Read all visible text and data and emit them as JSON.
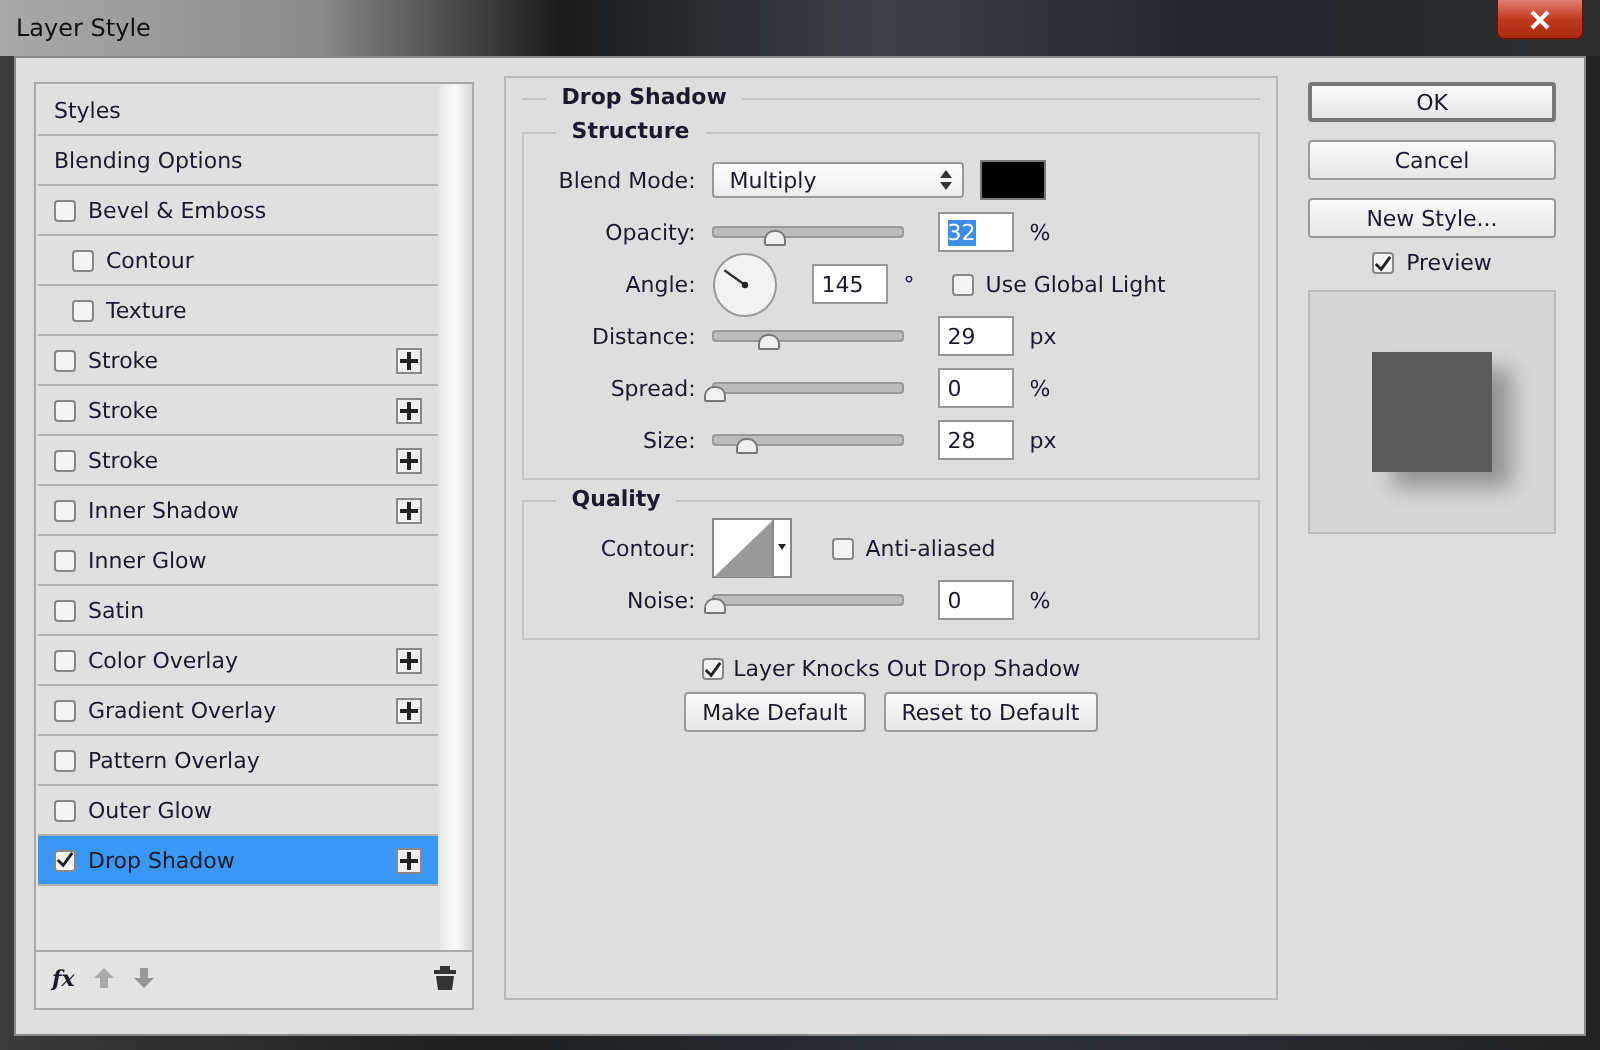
{
  "window": {
    "title": "Layer Style"
  },
  "sidebar": {
    "items": [
      {
        "kind": "header",
        "label": "Styles",
        "selected": false
      },
      {
        "kind": "header",
        "label": "Blending Options",
        "selected": false
      },
      {
        "kind": "effect",
        "label": "Bevel & Emboss",
        "checked": false,
        "selected": false,
        "addable": false,
        "children": [
          {
            "kind": "effect",
            "label": "Contour",
            "checked": false,
            "selected": false,
            "addable": false
          },
          {
            "kind": "effect",
            "label": "Texture",
            "checked": false,
            "selected": false,
            "addable": false
          }
        ]
      },
      {
        "kind": "effect",
        "label": "Stroke",
        "checked": false,
        "selected": false,
        "addable": true
      },
      {
        "kind": "effect",
        "label": "Stroke",
        "checked": false,
        "selected": false,
        "addable": true
      },
      {
        "kind": "effect",
        "label": "Stroke",
        "checked": false,
        "selected": false,
        "addable": true
      },
      {
        "kind": "effect",
        "label": "Inner Shadow",
        "checked": false,
        "selected": false,
        "addable": true
      },
      {
        "kind": "effect",
        "label": "Inner Glow",
        "checked": false,
        "selected": false,
        "addable": false
      },
      {
        "kind": "effect",
        "label": "Satin",
        "checked": false,
        "selected": false,
        "addable": false
      },
      {
        "kind": "effect",
        "label": "Color Overlay",
        "checked": false,
        "selected": false,
        "addable": true
      },
      {
        "kind": "effect",
        "label": "Gradient Overlay",
        "checked": false,
        "selected": false,
        "addable": true
      },
      {
        "kind": "effect",
        "label": "Pattern Overlay",
        "checked": false,
        "selected": false,
        "addable": false
      },
      {
        "kind": "effect",
        "label": "Outer Glow",
        "checked": false,
        "selected": false,
        "addable": false
      },
      {
        "kind": "effect",
        "label": "Drop Shadow",
        "checked": true,
        "selected": true,
        "addable": true
      }
    ],
    "footer": {
      "fx_label": "fx"
    }
  },
  "panel": {
    "title": "Drop Shadow",
    "structure": {
      "title": "Structure",
      "rows": [
        {
          "kind": "select",
          "label": "Blend Mode:",
          "value": "Multiply",
          "color": "#000000"
        },
        {
          "kind": "slider",
          "label": "Opacity:",
          "level": 0.32,
          "value": "32",
          "unit": "%",
          "highlighted": true
        },
        {
          "kind": "angle",
          "label": "Angle:",
          "value": "145",
          "unit": "°",
          "checkbox": {
            "label": "Use Global Light",
            "checked": false
          }
        },
        {
          "kind": "slider",
          "label": "Distance:",
          "level": 0.29,
          "value": "29",
          "unit": "px",
          "highlighted": false
        },
        {
          "kind": "slider",
          "label": "Spread:",
          "level": 0,
          "value": "0",
          "unit": "%",
          "highlighted": false
        },
        {
          "kind": "slider",
          "label": "Size:",
          "level": 0.17,
          "value": "28",
          "unit": "px",
          "highlighted": false
        }
      ]
    },
    "quality": {
      "title": "Quality",
      "rows": [
        {
          "kind": "contour",
          "label": "Contour:",
          "checkbox": {
            "label": "Anti-aliased",
            "checked": false
          }
        },
        {
          "kind": "slider",
          "label": "Noise:",
          "level": 0,
          "value": "0",
          "unit": "%",
          "highlighted": false
        }
      ]
    },
    "knockout": {
      "label": "Layer Knocks Out Drop Shadow",
      "checked": true
    },
    "buttons": [
      "Make Default",
      "Reset to Default"
    ]
  },
  "actions": {
    "buttons": [
      {
        "label": "OK",
        "default": true
      },
      {
        "label": "Cancel",
        "default": false
      },
      {
        "label": "New Style...",
        "default": false
      }
    ],
    "preview": {
      "label": "Preview",
      "checked": true
    }
  }
}
